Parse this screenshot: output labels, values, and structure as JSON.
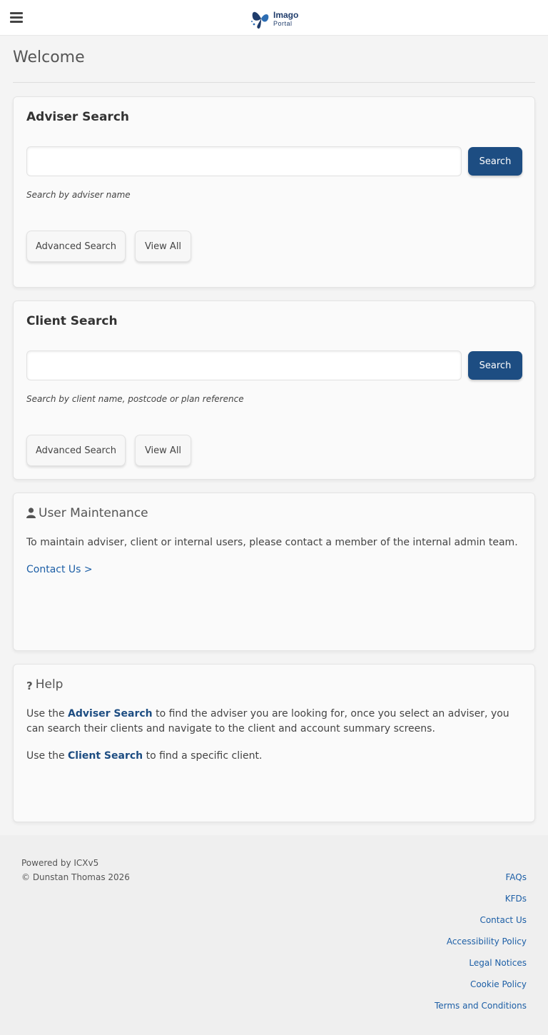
{
  "header": {
    "menu_icon": "hamburger-menu-icon",
    "logo_line1": "Imago",
    "logo_line2": "Portal"
  },
  "page": {
    "title": "Welcome"
  },
  "adviser_search": {
    "title": "Adviser Search",
    "input_value": "",
    "search_label": "Search",
    "hint": "Search by adviser name",
    "advanced_label": "Advanced Search",
    "view_all_label": "View All"
  },
  "client_search": {
    "title": "Client Search",
    "input_value": "",
    "search_label": "Search",
    "hint": "Search by client name, postcode or plan reference",
    "advanced_label": "Advanced Search",
    "view_all_label": "View All"
  },
  "user_maintenance": {
    "title": "User Maintenance",
    "icon": "user-icon",
    "body": "To maintain adviser, client or internal users, please contact a member of the internal admin team.",
    "link": "Contact Us >"
  },
  "help": {
    "title": "Help",
    "icon": "question-icon",
    "p1_prefix": "Use the ",
    "p1_link": "Adviser Search",
    "p1_suffix": " to find the adviser you are looking for, once you select an adviser, you can search their clients and navigate to the client and account summary screens.",
    "p2_prefix": "Use the ",
    "p2_link": "Client Search",
    "p2_suffix": " to find a specific client."
  },
  "footer": {
    "powered_by": "Powered by ICXv5",
    "copyright": "© Dunstan Thomas 2026",
    "links": [
      "FAQs",
      "KFDs",
      "Contact Us",
      "Accessibility Policy",
      "Legal Notices",
      "Cookie Policy",
      "Terms and Conditions"
    ]
  },
  "colors": {
    "primary_button": "#1d4d82",
    "link": "#1d5fa6",
    "background": "#f4f4f4"
  }
}
